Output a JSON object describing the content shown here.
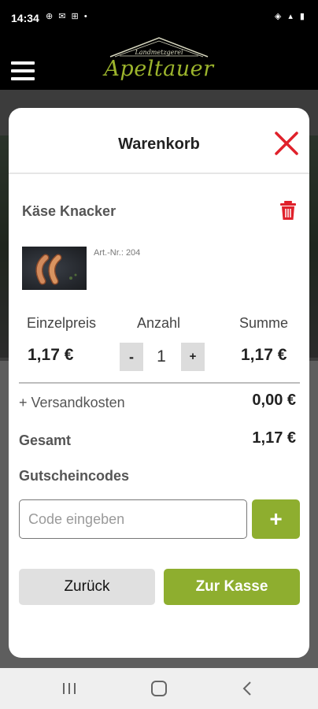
{
  "status_bar": {
    "time": "14:34",
    "left_icons": "⊕ ✉ ⊞ •",
    "right_icons": "◈ ▴ ▮"
  },
  "header": {
    "brand_sub": "Landmetzgerei",
    "brand_name": "Apeltauer",
    "brand_color": "#9cb42c"
  },
  "cart": {
    "title": "Warenkorb",
    "item": {
      "name": "Käse Knacker",
      "article_number": "Art.-Nr.: 204",
      "image": "sausages-photo"
    },
    "columns": {
      "unit_price_label": "Einzelpreis",
      "quantity_label": "Anzahl",
      "sum_label": "Summe"
    },
    "unit_price": "1,17 €",
    "quantity": "1",
    "minus_label": "-",
    "plus_label": "+",
    "sum": "1,17 €",
    "shipping_label": "+ Versandkosten",
    "shipping_value": "0,00 €",
    "total_label": "Gesamt",
    "total_value": "1,17 €",
    "coupon_label": "Gutscheincodes",
    "coupon_placeholder": "Code eingeben",
    "coupon_add_label": "+",
    "back_label": "Zurück",
    "checkout_label": "Zur Kasse"
  },
  "colors": {
    "accent_green": "#8eae2f",
    "danger_red": "#e0212b"
  },
  "nav": {
    "icons": [
      "recent-apps-icon",
      "home-icon",
      "back-icon"
    ]
  }
}
